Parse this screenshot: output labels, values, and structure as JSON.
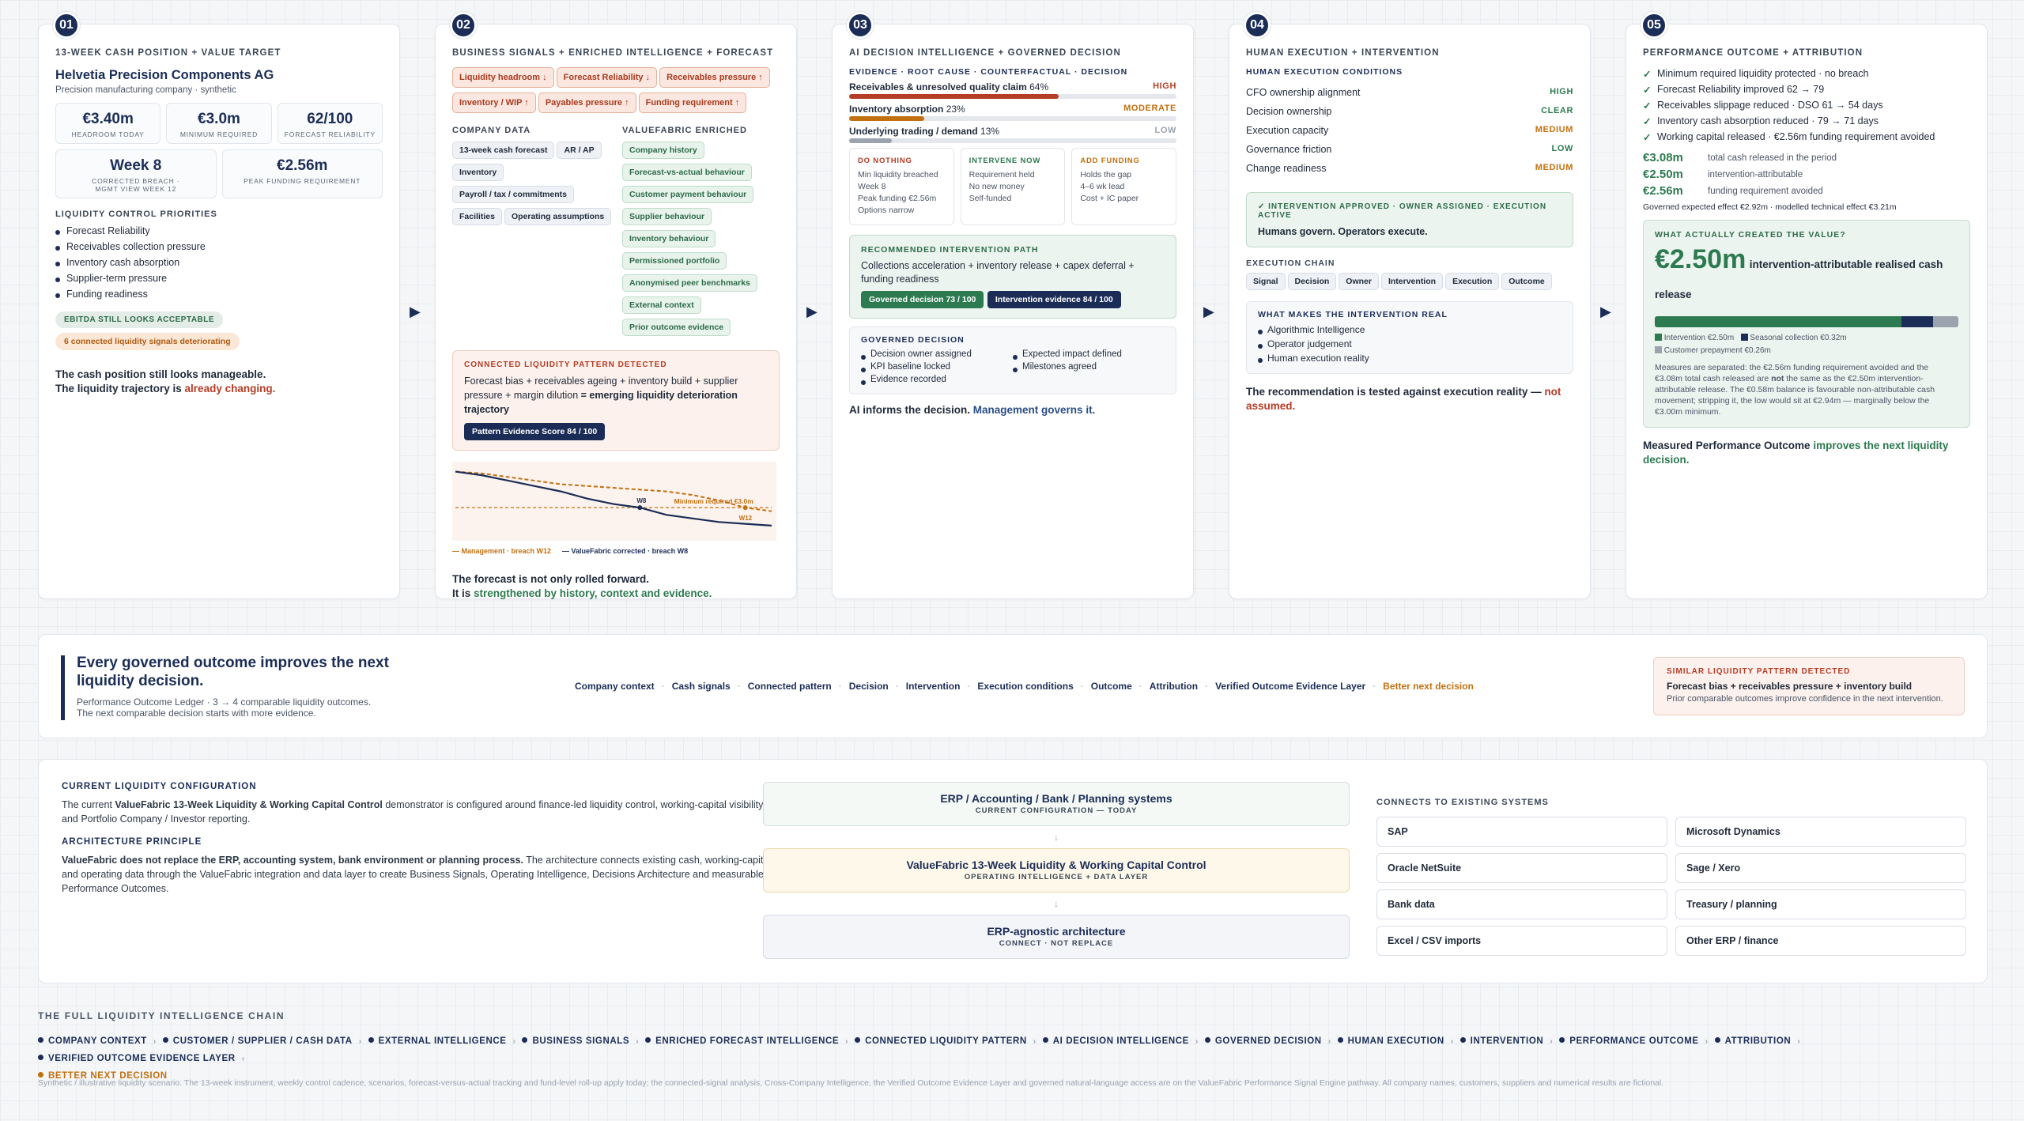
{
  "cards": [
    {
      "num": "01",
      "head": "13-week cash position + value target"
    },
    {
      "num": "02",
      "head": "Business signals + enriched intelligence + forecast"
    },
    {
      "num": "03",
      "head": "AI decision intelligence + governed decision"
    },
    {
      "num": "04",
      "head": "Human execution + intervention"
    },
    {
      "num": "05",
      "head": "Performance outcome + attribution"
    }
  ],
  "c1": {
    "company": "Helvetia Precision Components AG",
    "desc": "Precision manufacturing company · synthetic",
    "kpis": [
      {
        "v": "€3.40m",
        "l": "Headroom today"
      },
      {
        "v": "€3.0m",
        "l": "Minimum required"
      },
      {
        "v": "62/100",
        "l": "Forecast reliability"
      }
    ],
    "kpis2": [
      {
        "v": "Week 8",
        "l": "Corrected breach · Mgmt view week 12"
      },
      {
        "v": "€2.56m",
        "l": "Peak funding requirement"
      }
    ],
    "prio_head": "Liquidity control priorities",
    "prios": [
      "Forecast Reliability",
      "Receivables collection pressure",
      "Inventory cash absorption",
      "Supplier-term pressure",
      "Funding readiness"
    ],
    "pill1": "EBITDA still looks acceptable",
    "pill2": "6 connected liquidity signals deteriorating",
    "msg1": "The cash position still looks manageable.",
    "msg2a": "The liquidity trajectory is ",
    "msg2b": "already changing."
  },
  "c2": {
    "signals": [
      "Liquidity headroom ↓",
      "Forecast Reliability ↓",
      "Receivables pressure ↑",
      "Inventory / WIP ↑",
      "Payables pressure ↑",
      "Funding requirement ↑"
    ],
    "company_head": "Company data",
    "company": [
      "13-week cash forecast",
      "AR / AP",
      "Inventory",
      "Payroll / tax / commitments",
      "Facilities",
      "Operating assumptions"
    ],
    "vf_head": "ValueFabric enriched",
    "vf": [
      "Company history",
      "Forecast-vs-actual behaviour",
      "Customer payment behaviour",
      "Supplier behaviour",
      "Inventory behaviour",
      "Permissioned portfolio",
      "Anonymised peer benchmarks",
      "External context",
      "Prior outcome evidence"
    ],
    "pattern_head": "Connected liquidity pattern detected",
    "pattern_a": "Forecast bias + receivables ageing + inventory build + supplier pressure + margin dilution ",
    "pattern_b": "= emerging liquidity deterioration trajectory",
    "score": "Pattern Evidence Score 84 / 100",
    "min_label": "Minimum required €3.0m",
    "w8": "W8",
    "w12": "W12",
    "leg1": "— Management · breach W12",
    "leg2": "— ValueFabric corrected · breach W8",
    "msg1": "The forecast is not only rolled forward.",
    "msg2a": "It is ",
    "msg2b": "strengthened by history, context and evidence."
  },
  "c3": {
    "sub": "Evidence · root cause · counterfactual · decision",
    "drivers": [
      {
        "label": "Receivables & unresolved quality claim",
        "pct": "64%",
        "level": "HIGH",
        "frac": 0.64,
        "color": "#b53c25"
      },
      {
        "label": "Inventory absorption",
        "pct": "23%",
        "level": "MODERATE",
        "frac": 0.23,
        "color": "#c2700f"
      },
      {
        "label": "Underlying trading / demand",
        "pct": "13%",
        "level": "LOW",
        "frac": 0.13,
        "color": "#9aa3ae"
      }
    ],
    "options": [
      {
        "t": "Do nothing",
        "lines": [
          "Min liquidity breached",
          "Week 8",
          "Peak funding €2.56m",
          "Options narrow"
        ],
        "c": "#b53c25"
      },
      {
        "t": "Intervene now",
        "lines": [
          "Requirement held",
          "No new money",
          "Self-funded"
        ],
        "c": "#2c7a4f"
      },
      {
        "t": "Add funding",
        "lines": [
          "Holds the gap",
          "4–6 wk lead",
          "Cost + IC paper"
        ],
        "c": "#c2700f"
      }
    ],
    "rec_head": "Recommended intervention path",
    "rec": "Collections acceleration + inventory release + capex deferral + funding readiness",
    "btn1": "Governed decision 73 / 100",
    "btn2": "Intervention evidence 84 / 100",
    "gov_head": "Governed decision",
    "gov": [
      "Decision owner assigned",
      "Expected impact defined",
      "KPI baseline locked",
      "Milestones agreed",
      "Evidence recorded"
    ],
    "msg_a": "AI informs the decision. ",
    "msg_b": "Management governs it."
  },
  "c4": {
    "sub": "Human execution conditions",
    "conds": [
      {
        "l": "CFO ownership alignment",
        "v": "HIGH",
        "c": "#2c7a4f"
      },
      {
        "l": "Decision ownership",
        "v": "CLEAR",
        "c": "#2c7a4f"
      },
      {
        "l": "Execution capacity",
        "v": "MEDIUM",
        "c": "#c2700f"
      },
      {
        "l": "Governance friction",
        "v": "LOW",
        "c": "#2c7a4f"
      },
      {
        "l": "Change readiness",
        "v": "MEDIUM",
        "c": "#c2700f"
      }
    ],
    "approved": "✓ Intervention approved · owner assigned · execution active",
    "approved2": "Humans govern. Operators execute.",
    "chain_head": "Execution chain",
    "chain": [
      "Signal",
      "Decision",
      "Owner",
      "Intervention",
      "Execution",
      "Outcome"
    ],
    "real_head": "What makes the intervention real",
    "real": [
      "Algorithmic Intelligence",
      "Operator judgement",
      "Human execution reality"
    ],
    "msg_a": "The recommendation is tested against execution reality — ",
    "msg_b": "not assumed."
  },
  "c5": {
    "checks": [
      "Minimum required liquidity protected · no breach",
      "Forecast Reliability improved 62 → 79",
      "Receivables slippage reduced · DSO 61 → 54 days",
      "Inventory cash absorption reduced · 79 → 71 days",
      "Working capital released · €2.56m funding requirement avoided"
    ],
    "vals": [
      {
        "v": "€3.08m",
        "l": "total cash released in the period"
      },
      {
        "v": "€2.50m",
        "l": "intervention-attributable"
      },
      {
        "v": "€2.56m",
        "l": "funding requirement avoided"
      }
    ],
    "note": "Governed expected effect €2.92m · modelled technical effect €3.21m",
    "value_head": "What actually created the value?",
    "big": "€2.50m",
    "big_label": "intervention-attributable realised cash release",
    "split": [
      {
        "name": "Intervention €2.50m",
        "frac": 0.812,
        "color": "#2c7a4f"
      },
      {
        "name": "Seasonal collection €0.32m",
        "frac": 0.104,
        "color": "#1b2d57"
      },
      {
        "name": "Customer prepayment €0.26m",
        "frac": 0.084,
        "color": "#9aa3ae"
      }
    ],
    "measure_a": "Measures are separated: the €2.56m funding requirement avoided and the €3.08m total cash released are ",
    "measure_b": "not",
    "measure_c": " the same as the €2.50m intervention-attributable release. The €0.58m balance is favourable non-attributable cash movement; stripping it, the low would sit at €2.94m — marginally below the €3.00m minimum.",
    "msg_a": "Measured Performance Outcome ",
    "msg_b": "improves the next liquidity decision."
  },
  "ledger": {
    "title": "Every governed outcome improves the next liquidity decision.",
    "sub1": "Performance Outcome Ledger · 3 → 4 comparable liquidity outcomes.",
    "sub2": "The next comparable decision starts with more evidence.",
    "steps": [
      "Company context",
      "Cash signals",
      "Connected pattern",
      "Decision",
      "Intervention",
      "Execution conditions",
      "Outcome",
      "Attribution",
      "Verified Outcome Evidence Layer",
      "Better next decision"
    ],
    "similar_head": "Similar liquidity pattern detected",
    "similar": "Forecast bias + receivables pressure + inventory build",
    "similar2": "Prior comparable outcomes improve confidence in the next intervention."
  },
  "config": {
    "h1": "Current liquidity configuration",
    "p1a": "The current ",
    "p1b": "ValueFabric 13-Week Liquidity & Working Capital Control",
    "p1c": " demonstrator is configured around finance-led liquidity control, working-capital visibility and Portfolio Company / Investor reporting.",
    "h2": "Architecture principle",
    "p2a": "ValueFabric does not replace the ERP, accounting system, bank environment or planning process.",
    "p2b": " The architecture connects existing cash, working-capital and operating data through the ValueFabric integration and data layer to create Business Signals, Operating Intelligence, Decisions Architecture and measurable Performance Outcomes.",
    "stack": [
      {
        "t": "ERP / Accounting / Bank / Planning systems",
        "s": "Current configuration — today"
      },
      {
        "t": "ValueFabric 13-Week Liquidity & Working Capital Control",
        "s": "Operating intelligence + data layer"
      },
      {
        "t": "ERP-agnostic architecture",
        "s": "Connect · not replace"
      }
    ],
    "sys_head": "Connects to existing systems",
    "systems": [
      "SAP",
      "Microsoft Dynamics",
      "Oracle NetSuite",
      "Sage / Xero",
      "Bank data",
      "Treasury / planning",
      "Excel / CSV imports",
      "Other ERP / finance"
    ]
  },
  "chain": {
    "head": "The full liquidity intelligence chain",
    "items": [
      "Company context",
      "Customer / supplier / cash data",
      "External intelligence",
      "Business signals",
      "Enriched forecast intelligence",
      "Connected liquidity pattern",
      "AI decision intelligence",
      "Governed decision",
      "Human execution",
      "Intervention",
      "Performance outcome",
      "Attribution",
      "Verified outcome evidence layer"
    ],
    "last": "Better next decision"
  },
  "footer": "Synthetic / illustrative liquidity scenario. The 13-week instrument, weekly control cadence, scenarios, forecast-versus-actual tracking and fund-level roll-up apply today; the connected-signal analysis, Cross-Company Intelligence, the Verified Outcome Evidence Layer and governed natural-language access are on the ValueFabric Performance Signal Engine pathway. All company names, customers, suppliers and numerical results are fictional.",
  "chart_data": {
    "type": "line",
    "x": [
      1,
      2,
      3,
      4,
      5,
      6,
      7,
      8,
      9,
      10,
      11,
      12,
      13
    ],
    "series": [
      {
        "name": "Management · breach W12",
        "values": [
          4.0,
          3.95,
          3.85,
          3.75,
          3.65,
          3.6,
          3.55,
          3.5,
          3.45,
          3.35,
          3.2,
          3.0,
          2.9
        ],
        "color": "#c2700f"
      },
      {
        "name": "ValueFabric corrected · breach W8",
        "values": [
          4.0,
          3.9,
          3.75,
          3.6,
          3.45,
          3.25,
          3.1,
          3.0,
          2.8,
          2.7,
          2.6,
          2.55,
          2.5
        ],
        "color": "#1b2d57"
      }
    ],
    "min": 3.0,
    "ylim": [
      2.3,
      4.1
    ]
  }
}
